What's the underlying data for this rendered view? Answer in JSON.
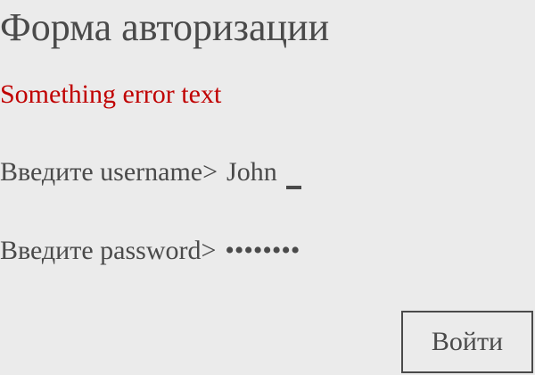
{
  "form": {
    "title": "Форма авторизации",
    "error_text": "Something error text",
    "username": {
      "prompt": "Введите username>",
      "value": "John"
    },
    "password": {
      "prompt": "Введите password>",
      "masked_value": "••••••••"
    },
    "submit_label": "Войти"
  },
  "colors": {
    "background": "#ebebeb",
    "text": "#4a4a4a",
    "error": "#c00000"
  }
}
